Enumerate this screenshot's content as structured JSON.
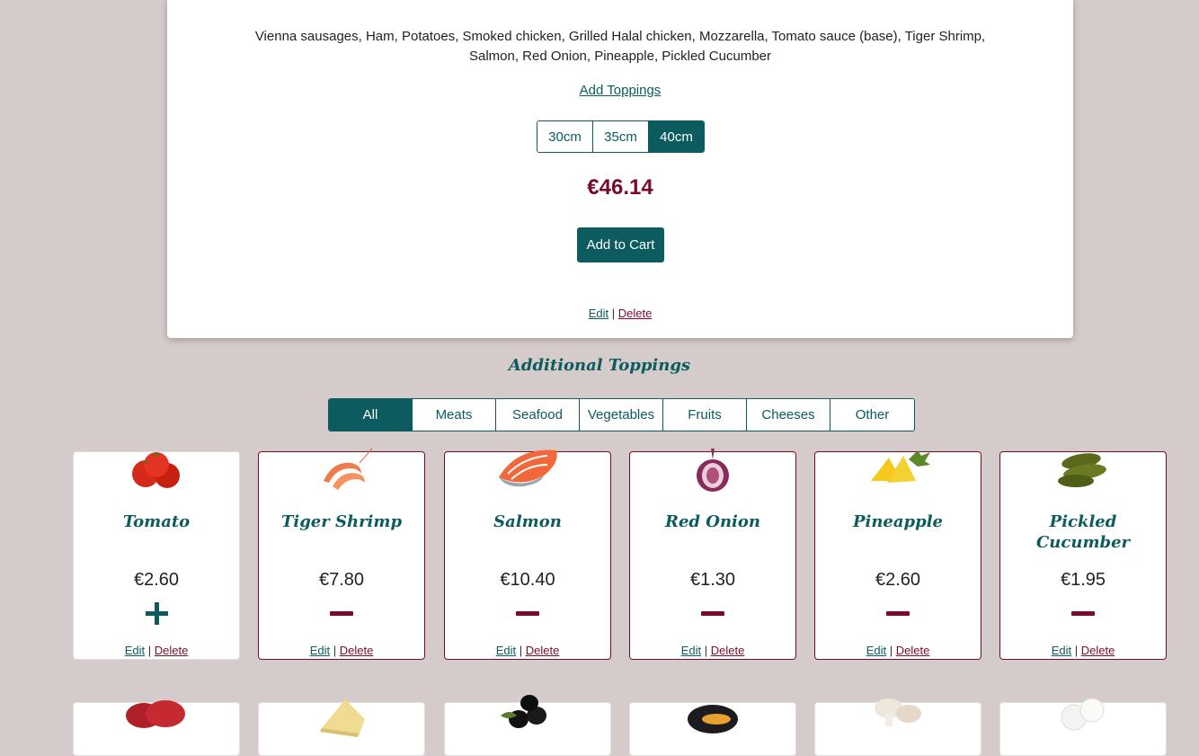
{
  "product": {
    "ingredients": "Vienna sausages, Ham, Potatoes, Smoked chicken, Grilled Halal chicken, Mozzarella, Tomato sauce (base), Tiger Shrimp, Salmon, Red Onion, Pineapple, Pickled Cucumber",
    "add_toppings_label": "Add Toppings",
    "sizes": [
      "30cm",
      "35cm",
      "40cm"
    ],
    "selected_size": "40cm",
    "price": "€46.14",
    "add_to_cart_label": "Add to Cart",
    "edit_label": "Edit",
    "delete_label": "Delete",
    "separator": "|"
  },
  "toppings_section": {
    "title": "Additional Toppings",
    "filters": [
      "All",
      "Meats",
      "Seafood",
      "Vegetables",
      "Fruits",
      "Cheeses",
      "Other"
    ],
    "active_filter": "All",
    "items": [
      {
        "name": "Tomato",
        "price": "€2.60",
        "selected": false,
        "icon": "tomato-image"
      },
      {
        "name": "Tiger Shrimp",
        "price": "€7.80",
        "selected": true,
        "icon": "shrimp-image"
      },
      {
        "name": "Salmon",
        "price": "€10.40",
        "selected": true,
        "icon": "salmon-image"
      },
      {
        "name": "Red Onion",
        "price": "€1.30",
        "selected": true,
        "icon": "red-onion-image"
      },
      {
        "name": "Pineapple",
        "price": "€2.60",
        "selected": true,
        "icon": "pineapple-image"
      },
      {
        "name": "Pickled Cucumber",
        "price": "€1.95",
        "selected": true,
        "icon": "pickles-image"
      }
    ],
    "next_row_icons": [
      "salami-image",
      "cheese-image",
      "olives-image",
      "mussel-image",
      "mushroom-image",
      "mozzarella-image"
    ],
    "edit_label": "Edit",
    "delete_label": "Delete",
    "separator": "|"
  },
  "colors": {
    "accent": "#0c5b5e",
    "price": "#7a0a2b",
    "background": "#d6cbcb"
  }
}
